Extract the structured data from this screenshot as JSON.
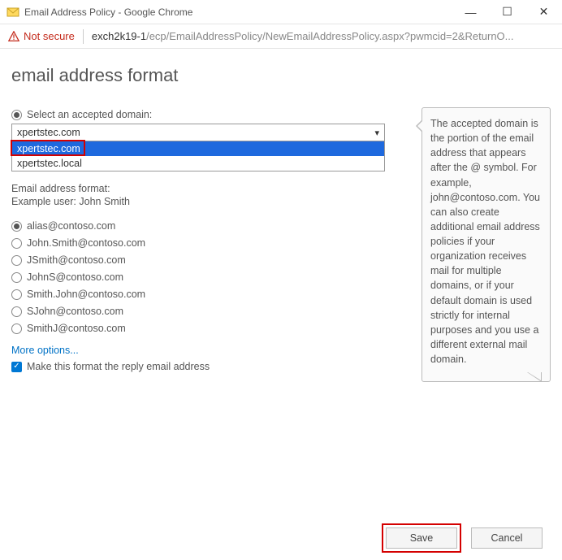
{
  "window": {
    "title": "Email Address Policy - Google Chrome"
  },
  "address": {
    "notsecure": "Not secure",
    "host": "exch2k19-1",
    "path": "/ecp/EmailAddressPolicy/NewEmailAddressPolicy.aspx?pwmcid=2&ReturnO..."
  },
  "page": {
    "heading": "email address format",
    "domain_label": "Select an accepted domain:",
    "selected_domain": "xpertstec.com",
    "dropdown": [
      "xpertstec.com",
      "xpertstec.local"
    ],
    "format_label": "Email address format:",
    "example_label": "Example user: John Smith",
    "formats": [
      {
        "label": "alias@contoso.com",
        "checked": true
      },
      {
        "label": "John.Smith@contoso.com",
        "checked": false
      },
      {
        "label": "JSmith@contoso.com",
        "checked": false
      },
      {
        "label": "JohnS@contoso.com",
        "checked": false
      },
      {
        "label": "Smith.John@contoso.com",
        "checked": false
      },
      {
        "label": "SJohn@contoso.com",
        "checked": false
      },
      {
        "label": "SmithJ@contoso.com",
        "checked": false
      }
    ],
    "more_link": "More options...",
    "reply_checkbox": "Make this format the reply email address"
  },
  "help": {
    "text": "The accepted domain is the portion of the email address that appears after the @ symbol. For example, john@contoso.com. You can also create additional email address policies if your organization receives mail for multiple domains, or if your default domain is used strictly for internal purposes and you use a different external mail domain."
  },
  "buttons": {
    "save": "Save",
    "cancel": "Cancel"
  }
}
